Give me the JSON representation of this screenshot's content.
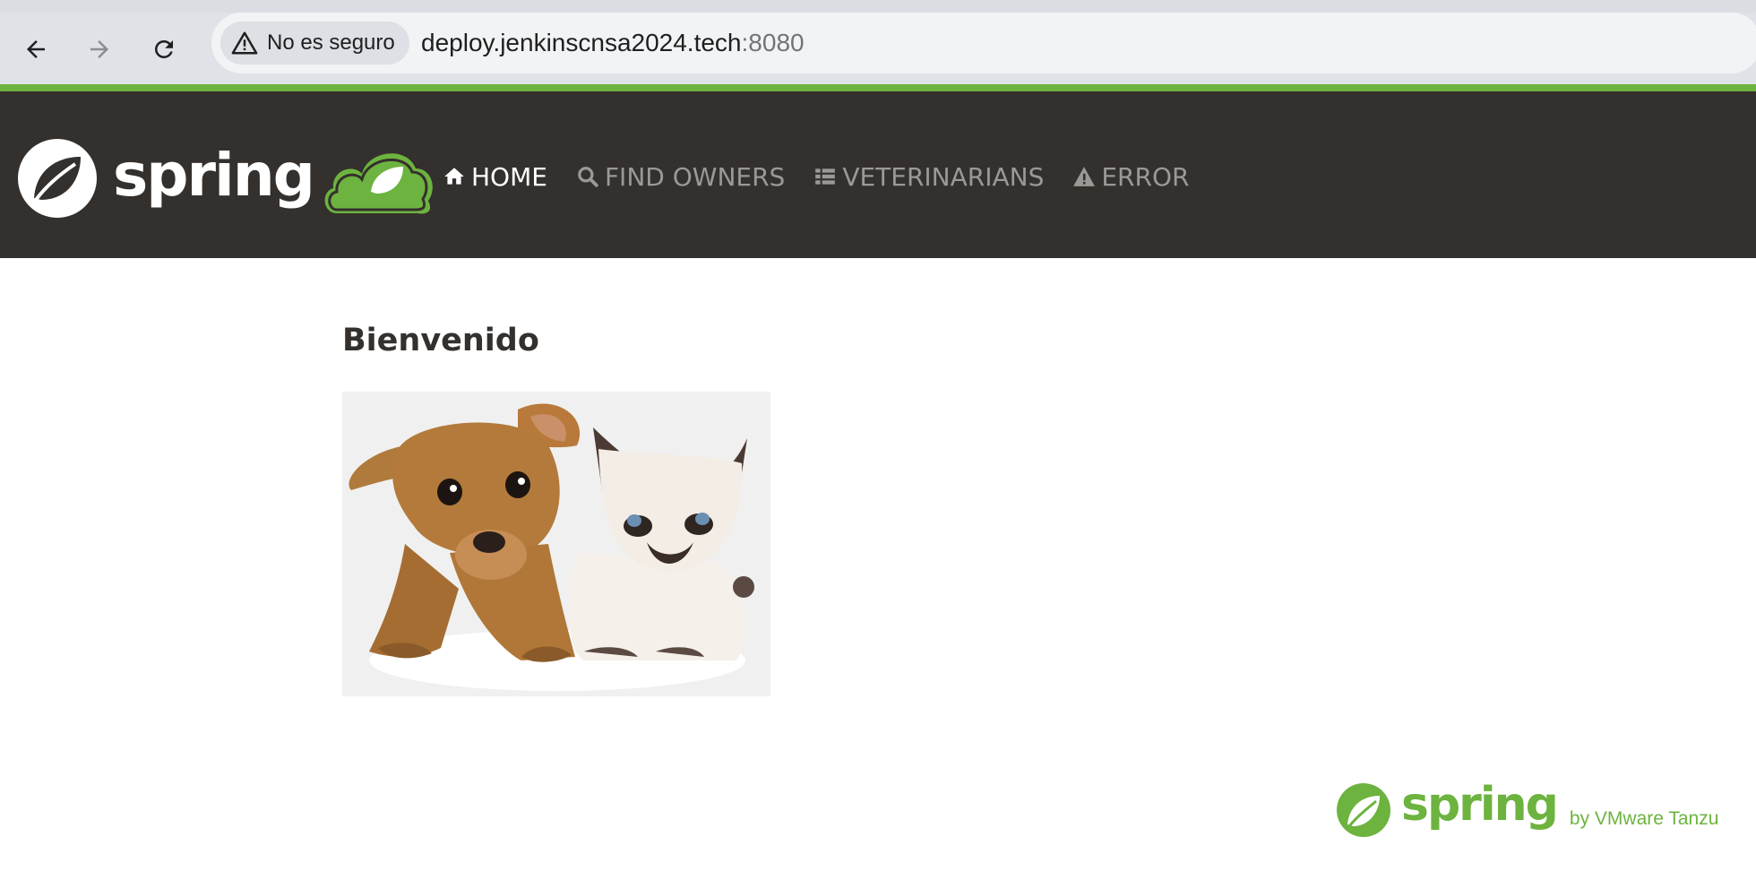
{
  "browser": {
    "security_label": "No es seguro",
    "url_host": "deploy.jenkinscnsa2024.tech",
    "url_port": ":8080"
  },
  "nav": {
    "brand": "spring",
    "items": [
      {
        "label": "HOME",
        "icon": "home-icon",
        "active": true
      },
      {
        "label": "FIND OWNERS",
        "icon": "search-icon",
        "active": false
      },
      {
        "label": "VETERINARIANS",
        "icon": "list-icon",
        "active": false
      },
      {
        "label": "ERROR",
        "icon": "warning-icon",
        "active": false
      }
    ]
  },
  "main": {
    "title": "Bienvenido"
  },
  "footer": {
    "brand": "spring",
    "tagline": "by VMware Tanzu"
  },
  "colors": {
    "spring_green": "#6db33f",
    "navbar_bg": "#34302d"
  }
}
